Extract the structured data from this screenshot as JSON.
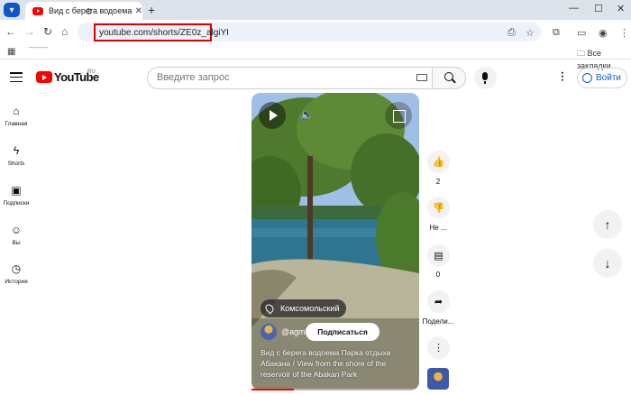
{
  "browser": {
    "tab_title": "Вид с берега водоема Парка о",
    "url": "youtube.com/shorts/ZE0z_algiYI",
    "bookmarks_folder": "Все закладки"
  },
  "header": {
    "logo_text": "YouTube",
    "country_code": "RU",
    "search_placeholder": "Введите запрос",
    "signin_label": "Войти"
  },
  "sidebar": {
    "items": [
      {
        "label": "Главная",
        "icon": "home-icon"
      },
      {
        "label": "Shorts",
        "icon": "shorts-icon"
      },
      {
        "label": "Подписки",
        "icon": "subscriptions-icon"
      },
      {
        "label": "Вы",
        "icon": "you-icon"
      },
      {
        "label": "История",
        "icon": "history-icon"
      }
    ]
  },
  "video": {
    "location": "Комсомольский",
    "channel": "@agmioli",
    "subscribe_label": "Подписаться",
    "title": "Вид с берега водоема Парка отдыха Абакана / View from the shore of the reservoir of the Abakan Park",
    "progress_fraction": 0.25
  },
  "actions": {
    "like_count": "2",
    "dislike_label": "Не ...",
    "comments_count": "0",
    "share_label": "Подели..."
  },
  "colors": {
    "accent": "#065fd4",
    "brand": "#ff0000",
    "url_highlight": "#e00000"
  }
}
